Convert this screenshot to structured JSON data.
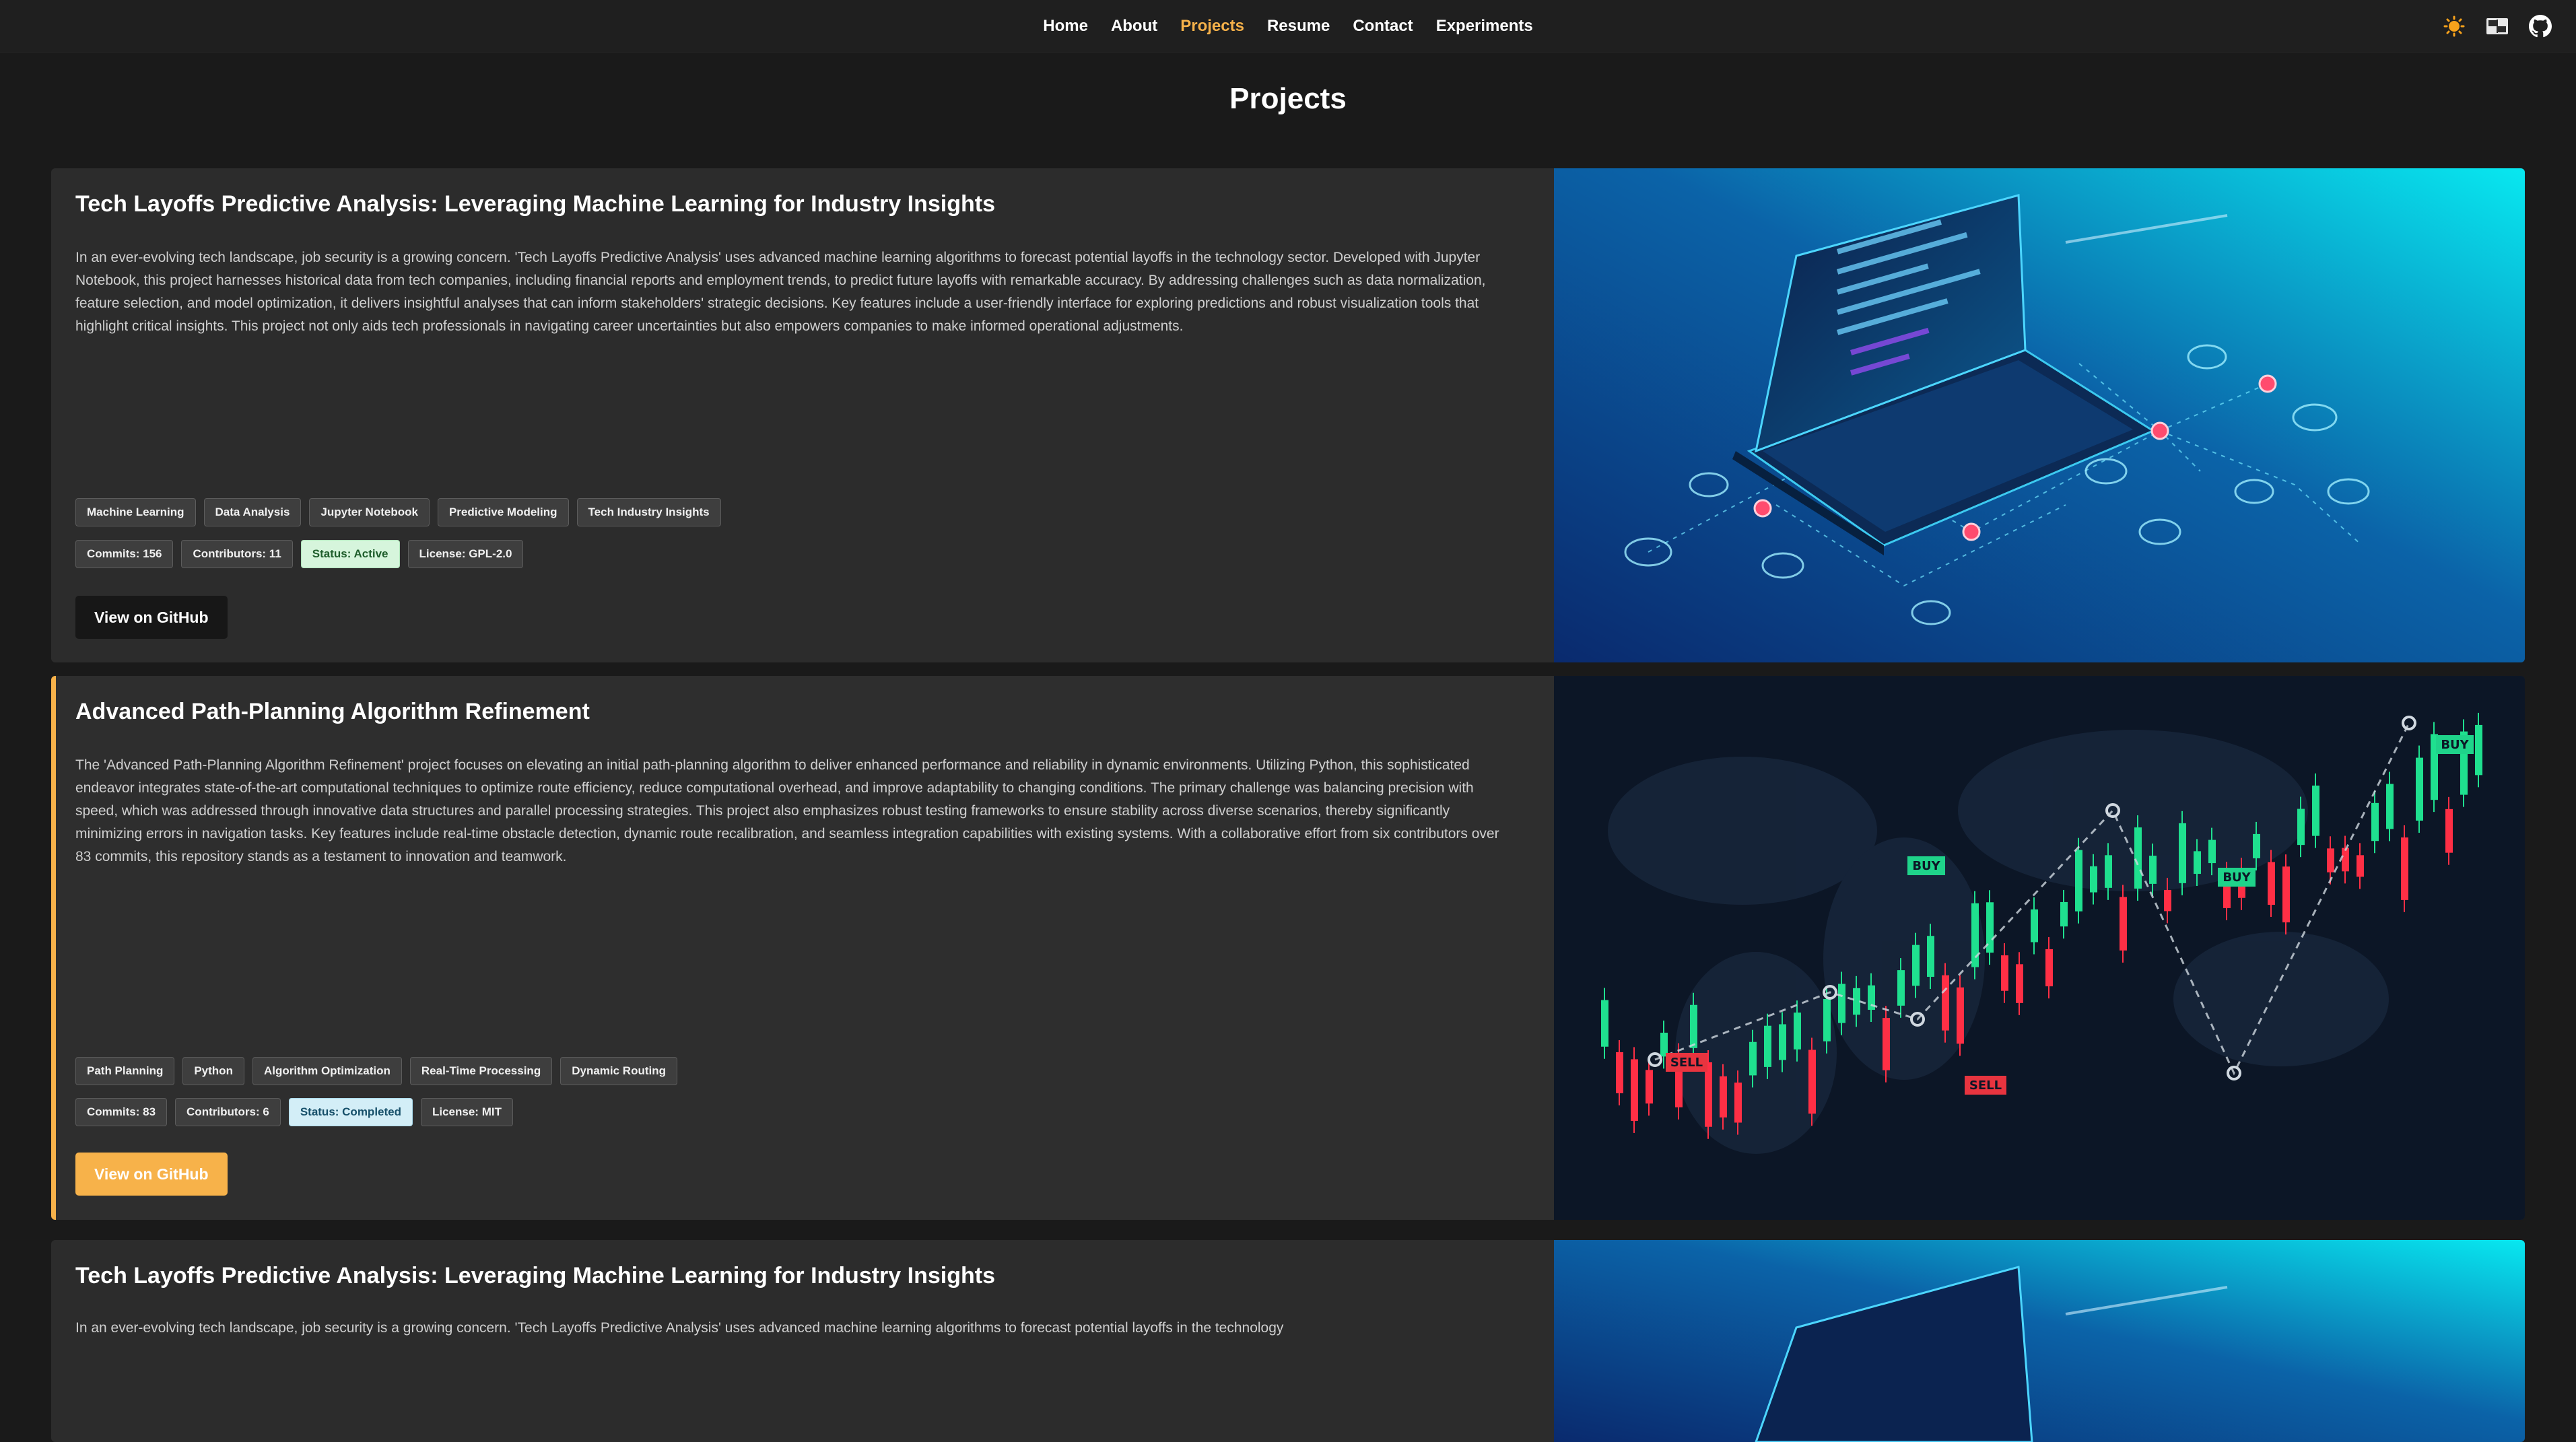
{
  "nav": {
    "links": [
      {
        "label": "Home",
        "active": false
      },
      {
        "label": "About",
        "active": false
      },
      {
        "label": "Projects",
        "active": true
      },
      {
        "label": "Resume",
        "active": false
      },
      {
        "label": "Contact",
        "active": false
      },
      {
        "label": "Experiments",
        "active": false
      }
    ],
    "icons": [
      "sun-icon",
      "language-icon",
      "github-icon"
    ]
  },
  "page": {
    "title": "Projects"
  },
  "colors": {
    "accent": "#f7b24a",
    "background": "#1a1a1a",
    "card": "#2c2c2c"
  },
  "projects": [
    {
      "title": "Tech Layoffs Predictive Analysis: Leveraging Machine Learning for Industry Insights",
      "description": "In an ever-evolving tech landscape, job security is a growing concern. 'Tech Layoffs Predictive Analysis' uses advanced machine learning algorithms to forecast potential layoffs in the technology sector. Developed with Jupyter Notebook, this project harnesses historical data from tech companies, including financial reports and employment trends, to predict future layoffs with remarkable accuracy. By addressing challenges such as data normalization, feature selection, and model optimization, it delivers insightful analyses that can inform stakeholders' strategic decisions. Key features include a user-friendly interface for exploring predictions and robust visualization tools that highlight critical insights. This project not only aids tech professionals in navigating career uncertainties but also empowers companies to make informed operational adjustments.",
      "tags": [
        "Machine Learning",
        "Data Analysis",
        "Jupyter Notebook",
        "Predictive Modeling",
        "Tech Industry Insights"
      ],
      "stats": {
        "commits": "Commits: 156",
        "contributors": "Contributors: 11",
        "status": "Status: Active",
        "license": "License: GPL-2.0"
      },
      "button": "View on GitHub",
      "image": "laptop-network-illustration"
    },
    {
      "title": "Advanced Path-Planning Algorithm Refinement",
      "description": "The 'Advanced Path-Planning Algorithm Refinement' project focuses on elevating an initial path-planning algorithm to deliver enhanced performance and reliability in dynamic environments. Utilizing Python, this sophisticated endeavor integrates state-of-the-art computational techniques to optimize route efficiency, reduce computational overhead, and improve adaptability to changing conditions. The primary challenge was balancing precision with speed, which was addressed through innovative data structures and parallel processing strategies. This project also emphasizes robust testing frameworks to ensure stability across diverse scenarios, thereby significantly minimizing errors in navigation tasks. Key features include real-time obstacle detection, dynamic route recalibration, and seamless integration capabilities with existing systems. With a collaborative effort from six contributors over 83 commits, this repository stands as a testament to innovation and teamwork.",
      "tags": [
        "Path Planning",
        "Python",
        "Algorithm Optimization",
        "Real-Time Processing",
        "Dynamic Routing"
      ],
      "stats": {
        "commits": "Commits: 83",
        "contributors": "Contributors: 6",
        "status": "Status: Completed",
        "license": "License: MIT"
      },
      "button": "View on GitHub",
      "image": "trading-candlestick-illustration",
      "chart_labels": {
        "buy": "BUY",
        "sell": "SELL"
      }
    },
    {
      "title": "Tech Layoffs Predictive Analysis: Leveraging Machine Learning for Industry Insights",
      "description": "In an ever-evolving tech landscape, job security is a growing concern. 'Tech Layoffs Predictive Analysis' uses advanced machine learning algorithms to forecast potential layoffs in the technology",
      "image": "laptop-network-illustration"
    }
  ]
}
